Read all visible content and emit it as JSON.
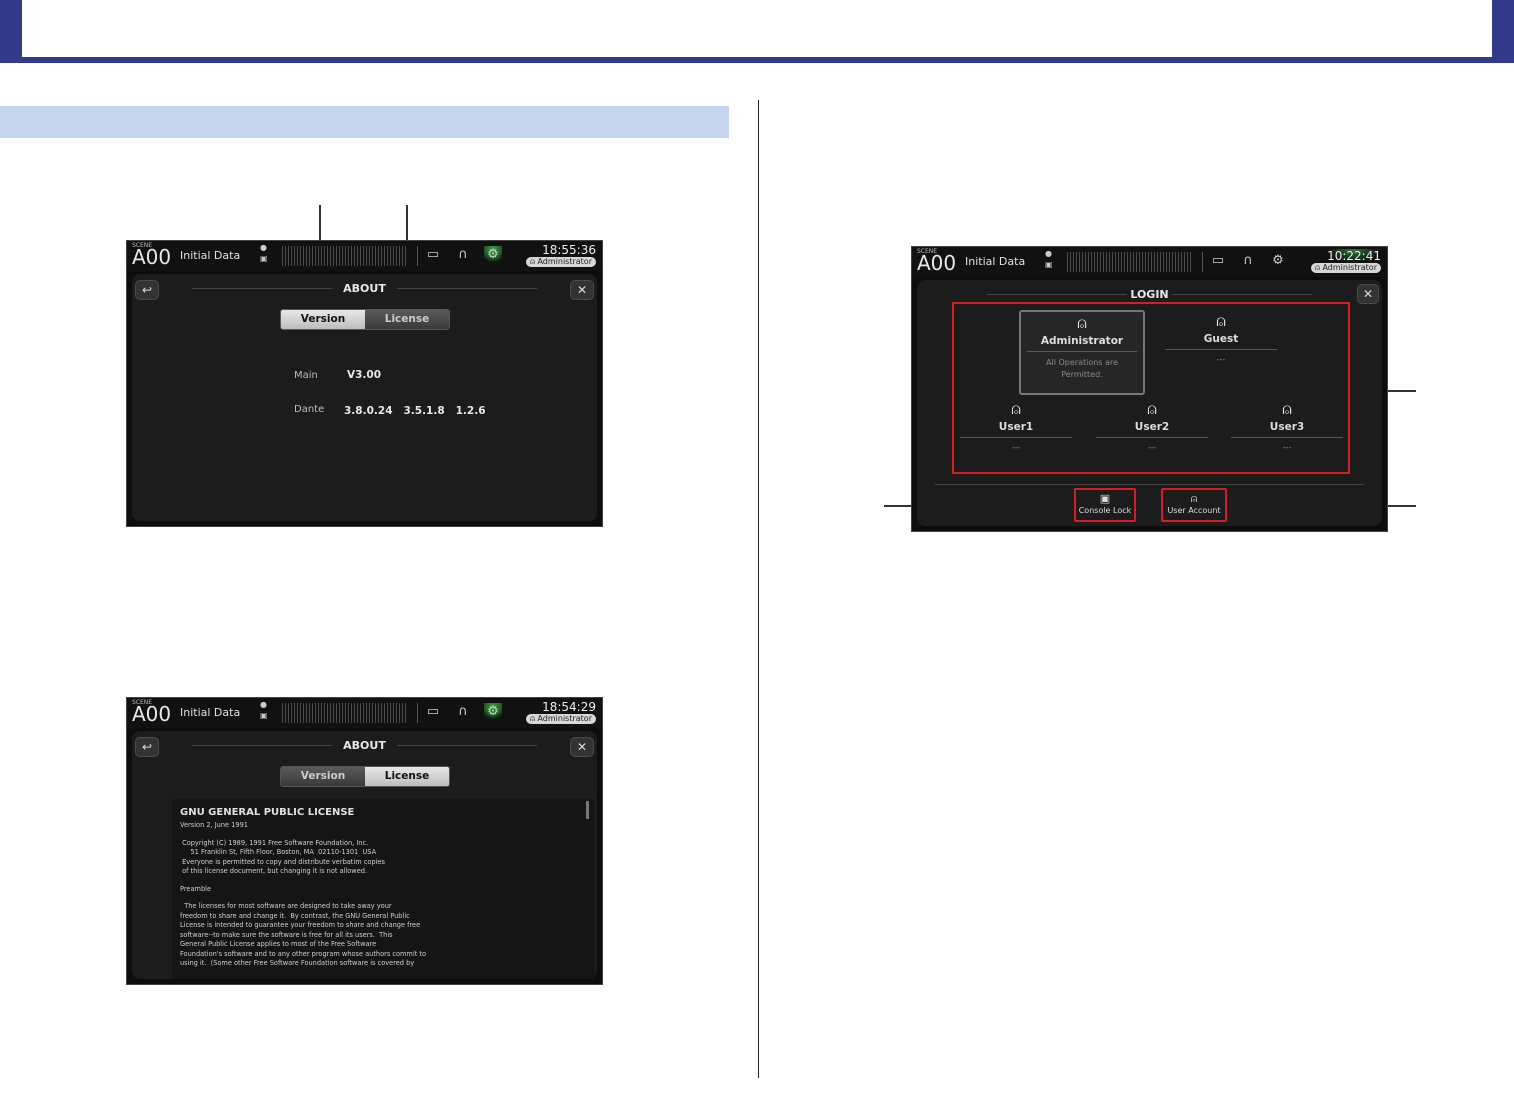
{
  "screen1": {
    "scene_label": "SCENE",
    "scene_number": "A00",
    "scene_name": "Initial Data",
    "time": "18:55:36",
    "user": "Administrator",
    "title": "ABOUT",
    "tabs": [
      "Version",
      "License"
    ],
    "active_tab": "Version",
    "versions": [
      {
        "label": "Main",
        "value": "V3.00"
      },
      {
        "label": "Dante",
        "value": "3.8.0.24   3.5.1.8   1.2.6"
      }
    ]
  },
  "screen2": {
    "scene_label": "SCENE",
    "scene_number": "A00",
    "scene_name": "Initial Data",
    "time": "18:54:29",
    "user": "Administrator",
    "title": "ABOUT",
    "tabs": [
      "Version",
      "License"
    ],
    "active_tab": "License",
    "license_title": "GNU GENERAL PUBLIC LICENSE",
    "license_lines": [
      "Version 2, June 1991",
      "",
      " Copyright (C) 1989, 1991 Free Software Foundation, Inc.",
      "     51 Franklin St, Fifth Floor, Boston, MA  02110-1301  USA",
      " Everyone is permitted to copy and distribute verbatim copies",
      " of this license document, but changing it is not allowed.",
      "",
      "Preamble",
      "",
      "  The licenses for most software are designed to take away your",
      "freedom to share and change it.  By contrast, the GNU General Public",
      "License is intended to guarantee your freedom to share and change free",
      "software--to make sure the software is free for all its users.  This",
      "General Public License applies to most of the Free Software",
      "Foundation's software and to any other program whose authors commit to",
      "using it.  (Some other Free Software Foundation software is covered by"
    ]
  },
  "screen3": {
    "scene_label": "SCENE",
    "scene_number": "A00",
    "scene_name": "Initial Data",
    "time": "10:22:41",
    "user": "Administrator",
    "title": "LOGIN",
    "accounts": [
      {
        "name": "Administrator",
        "desc": "All Operations are Permitted."
      },
      {
        "name": "Guest",
        "desc": "---"
      },
      {
        "name": "User1",
        "desc": "---"
      },
      {
        "name": "User2",
        "desc": "---"
      },
      {
        "name": "User3",
        "desc": "---"
      }
    ],
    "buttons": [
      "Console Lock",
      "User Account"
    ]
  },
  "icons": {
    "back": "↩",
    "close": "✕",
    "user": "⍝",
    "lock": "🔒︎",
    "headphones": "🎧︎",
    "gear": "⚙",
    "recorder": "▭"
  }
}
